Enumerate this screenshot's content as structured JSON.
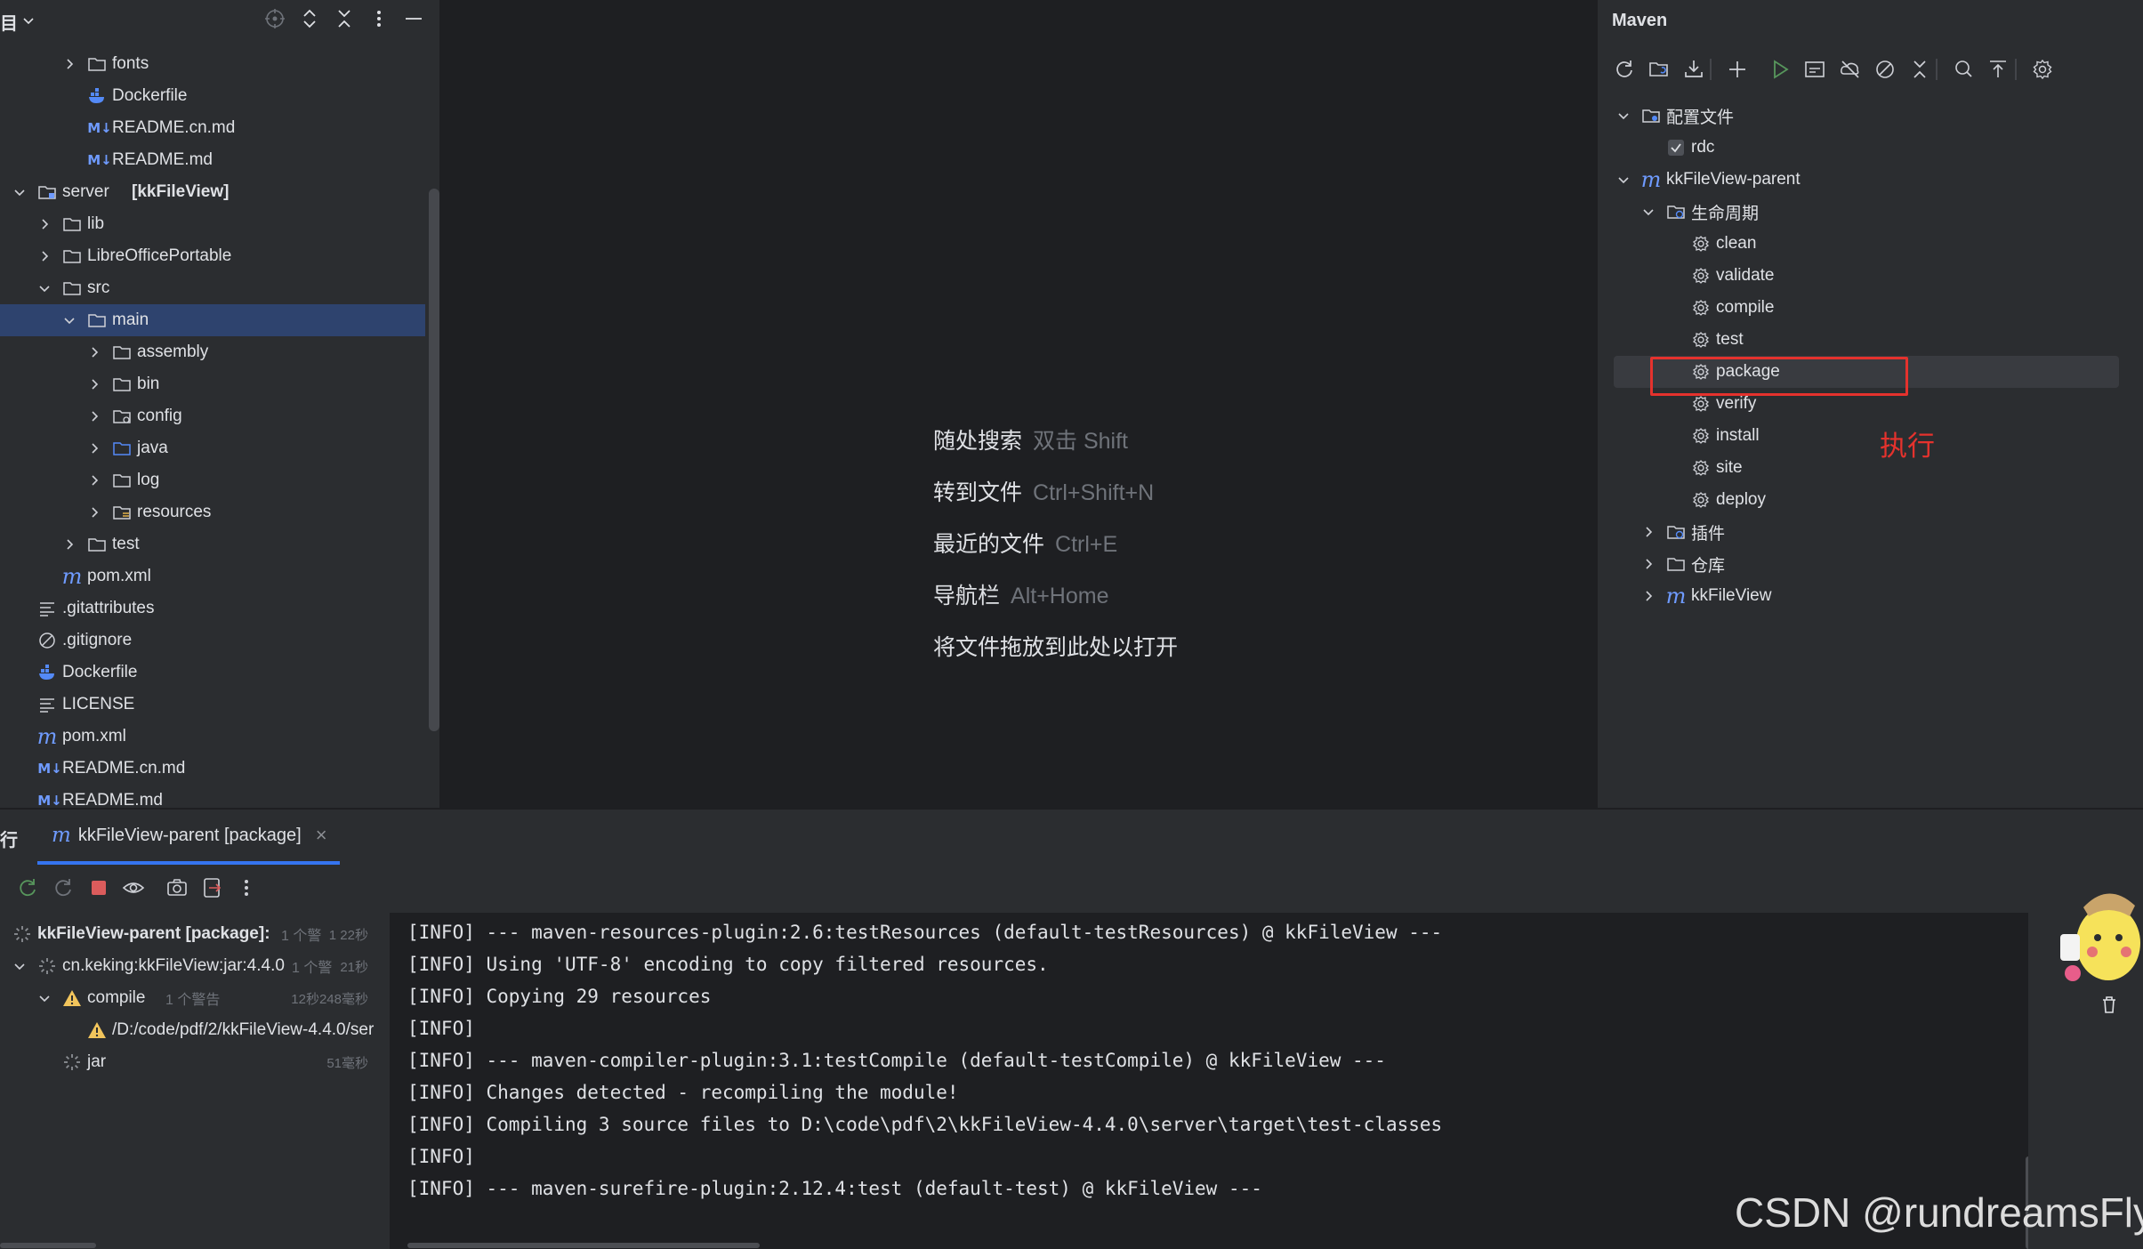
{
  "project": {
    "header_title": "目",
    "tree": [
      {
        "label": "fonts",
        "icon": "folder-icon"
      },
      {
        "label": "Dockerfile",
        "icon": "docker-icon"
      },
      {
        "label": "README.cn.md",
        "icon": "markdown-icon"
      },
      {
        "label": "README.md",
        "icon": "markdown-icon"
      },
      {
        "label": "server",
        "bold_suffix": "[kkFileView]",
        "icon": "module-folder-icon"
      },
      {
        "label": "lib",
        "icon": "folder-icon"
      },
      {
        "label": "LibreOfficePortable",
        "icon": "folder-icon"
      },
      {
        "label": "src",
        "icon": "folder-icon"
      },
      {
        "label": "main",
        "icon": "folder-icon",
        "selected": true
      },
      {
        "label": "assembly",
        "icon": "folder-icon"
      },
      {
        "label": "bin",
        "icon": "folder-icon"
      },
      {
        "label": "config",
        "icon": "config-folder-icon"
      },
      {
        "label": "java",
        "icon": "source-folder-icon"
      },
      {
        "label": "log",
        "icon": "folder-icon"
      },
      {
        "label": "resources",
        "icon": "resources-folder-icon"
      },
      {
        "label": "test",
        "icon": "folder-icon"
      },
      {
        "label": "pom.xml",
        "icon": "maven-icon"
      },
      {
        "label": ".gitattributes",
        "icon": "text-file-icon"
      },
      {
        "label": ".gitignore",
        "icon": "ignore-file-icon"
      },
      {
        "label": "Dockerfile",
        "icon": "docker-icon"
      },
      {
        "label": "LICENSE",
        "icon": "text-file-icon"
      },
      {
        "label": "pom.xml",
        "icon": "maven-icon"
      },
      {
        "label": "README.cn.md",
        "icon": "markdown-icon"
      },
      {
        "label": "README.md",
        "icon": "markdown-icon"
      }
    ],
    "md_glyph": "M↓",
    "m_glyph": "m"
  },
  "editor_hints": [
    {
      "label": "随处搜索",
      "key": "双击 Shift"
    },
    {
      "label": "转到文件",
      "key": "Ctrl+Shift+N"
    },
    {
      "label": "最近的文件",
      "key": "Ctrl+E"
    },
    {
      "label": "导航栏",
      "key": "Alt+Home"
    },
    {
      "label": "将文件拖放到此处以打开",
      "key": ""
    }
  ],
  "maven": {
    "title": "Maven",
    "tree": [
      {
        "label": "配置文件",
        "icon": "profiles-folder-icon"
      },
      {
        "label": "rdc",
        "icon": "checkbox-checked-icon"
      },
      {
        "label": "kkFileView-parent",
        "icon": "maven-icon"
      },
      {
        "label": "生命周期",
        "icon": "lifecycle-folder-icon"
      },
      {
        "label": "clean",
        "icon": "gear-icon"
      },
      {
        "label": "validate",
        "icon": "gear-icon"
      },
      {
        "label": "compile",
        "icon": "gear-icon"
      },
      {
        "label": "test",
        "icon": "gear-icon"
      },
      {
        "label": "package",
        "icon": "gear-icon",
        "highlighted": true
      },
      {
        "label": "verify",
        "icon": "gear-icon"
      },
      {
        "label": "install",
        "icon": "gear-icon"
      },
      {
        "label": "site",
        "icon": "gear-icon"
      },
      {
        "label": "deploy",
        "icon": "gear-icon"
      },
      {
        "label": "插件",
        "icon": "plugins-folder-icon"
      },
      {
        "label": "仓库",
        "icon": "repository-folder-icon"
      },
      {
        "label": "kkFileView",
        "icon": "maven-icon"
      }
    ],
    "annotation": "执行",
    "m_glyph": "m"
  },
  "run": {
    "panel_title": "行",
    "tab_label": "kkFileView-parent [package]",
    "tab_close": "×",
    "tree": [
      {
        "label": "kkFileView-parent [package]:",
        "meta": "1 个警",
        "time": "1 22秒",
        "icon": "spinner-icon"
      },
      {
        "label": "cn.keking:kkFileView:jar:4.4.0",
        "meta": "1 个警",
        "time": "21秒",
        "icon": "spinner-icon"
      },
      {
        "label": "compile",
        "meta": "1 个警告",
        "time": "12秒248毫秒",
        "icon": "warning-icon"
      },
      {
        "label": "/D:/code/pdf/2/kkFileView-4.4.0/ser",
        "meta": "",
        "time": "",
        "icon": "warning-icon"
      },
      {
        "label": "jar",
        "meta": "",
        "time": "51毫秒",
        "icon": "spinner-icon"
      }
    ],
    "console": [
      "[INFO] --- maven-resources-plugin:2.6:testResources (default-testResources) @ kkFileView ---",
      "[INFO] Using 'UTF-8' encoding to copy filtered resources.",
      "[INFO] Copying 29 resources",
      "[INFO]",
      "[INFO] --- maven-compiler-plugin:3.1:testCompile (default-testCompile) @ kkFileView ---",
      "[INFO] Changes detected - recompiling the module!",
      "[INFO] Compiling 3 source files to D:\\code\\pdf\\2\\kkFileView-4.4.0\\server\\target\\test-classes",
      "[INFO]",
      "[INFO] --- maven-surefire-plugin:2.12.4:test (default-test) @ kkFileView ---"
    ]
  },
  "watermark": "CSDN @rundreamsFly",
  "colors": {
    "accent": "#3574f0",
    "selection": "#2e436e",
    "annotation_red": "#e5322d",
    "run_green": "#57965c",
    "stop_red": "#db5c5c",
    "warning_yellow": "#f2c55c"
  }
}
